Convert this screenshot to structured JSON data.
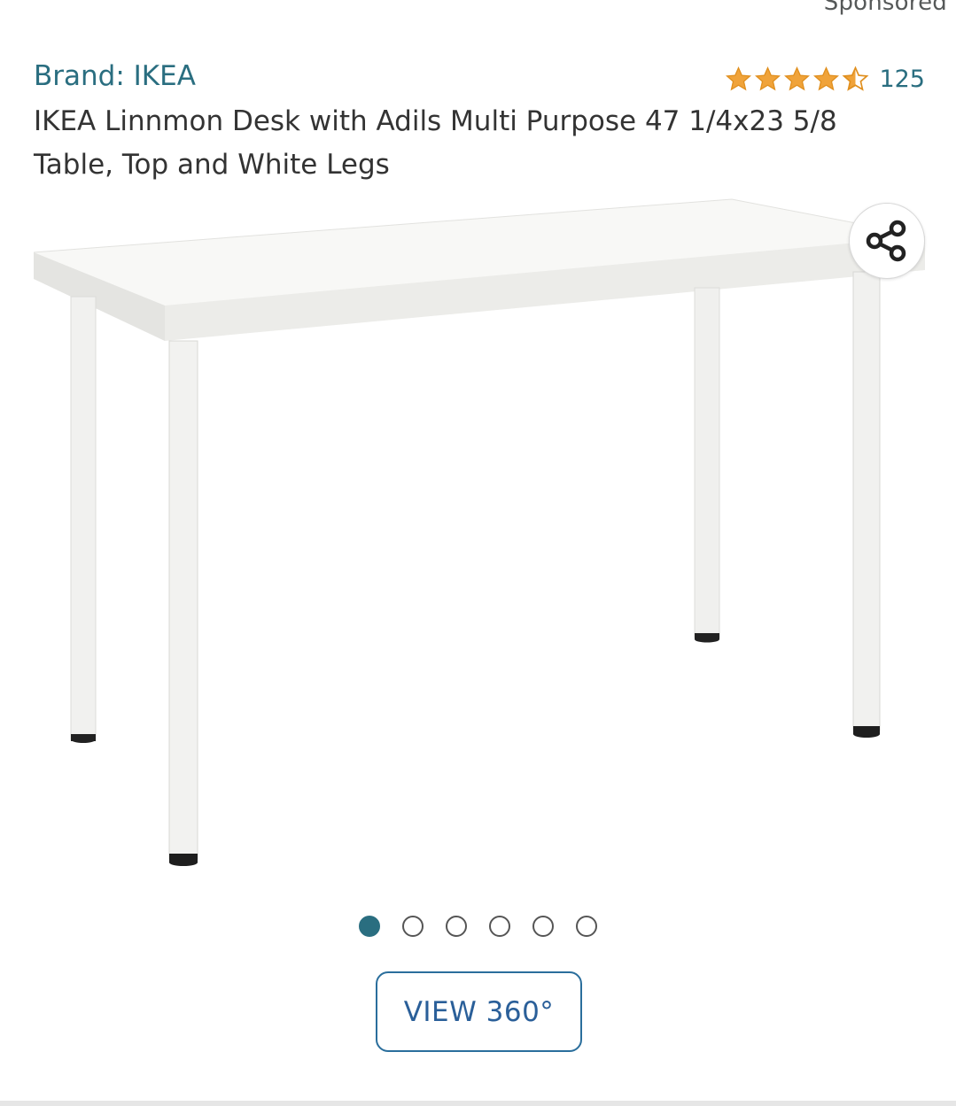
{
  "sponsored_label": "Sponsored",
  "brand": {
    "label": "Brand: IKEA"
  },
  "rating": {
    "value": 4.5,
    "max": 5,
    "count": "125",
    "star_color": "#f0a33a"
  },
  "product": {
    "title": "IKEA Linnmon Desk with Adils Multi Purpose 47 1/4x23 5/8 Table, Top and White Legs"
  },
  "share": {
    "icon": "share-icon"
  },
  "carousel": {
    "total": 6,
    "active_index": 0,
    "active_color": "#2a6e80"
  },
  "view360": {
    "label": "VIEW 360°"
  },
  "colors": {
    "link": "#2a6e80",
    "button_text": "#2a5f99"
  }
}
